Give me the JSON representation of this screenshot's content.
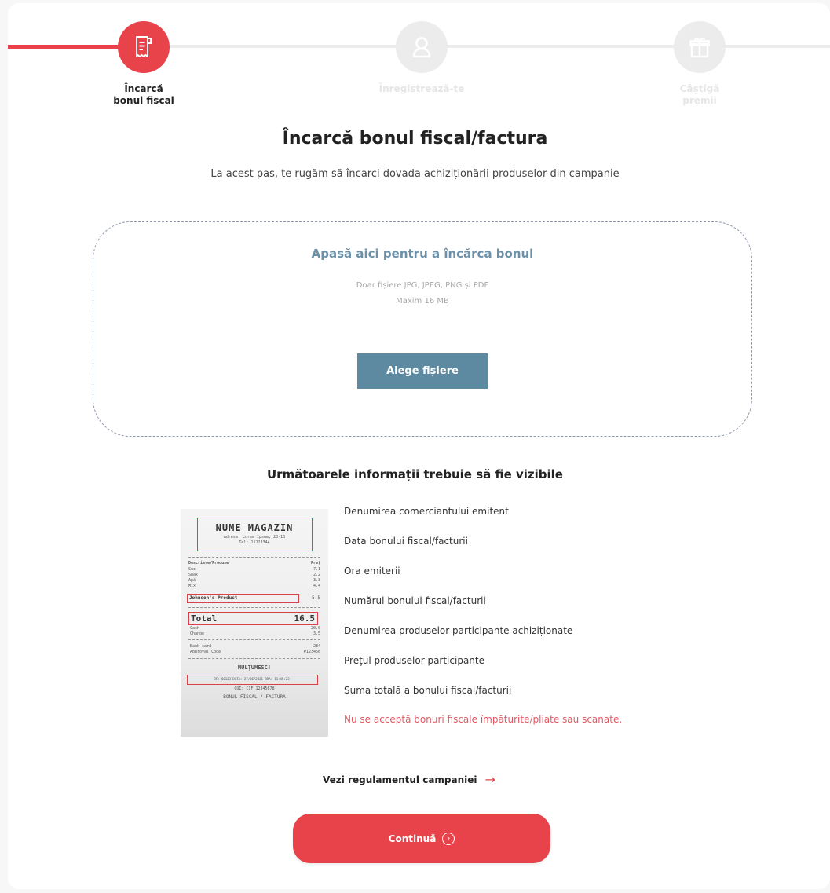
{
  "colors": {
    "accent": "#e8434a",
    "upload_blue": "#5d8aa1",
    "upload_title": "#6b90a8",
    "inactive": "#ececec",
    "warning": "#e05a63"
  },
  "stepper": {
    "steps": [
      {
        "label_line1": "Încarcă",
        "label_line2": "bonul fiscal",
        "icon": "receipt-icon",
        "state": "active"
      },
      {
        "label_line1": "Înregistrează-te",
        "label_line2": "",
        "icon": "user-icon",
        "state": "inactive"
      },
      {
        "label_line1": "Câștigă",
        "label_line2": "premii",
        "icon": "gift-icon",
        "state": "inactive"
      }
    ]
  },
  "main": {
    "title": "Încarcă bonul fiscal/factura",
    "subtitle": "La acest pas, te rugăm să încarci dovada achiziționării produselor din campanie"
  },
  "upload": {
    "title": "Apasă aici pentru a încărca bonul",
    "hint_types": "Doar fișiere JPG, JPEG, PNG și PDF",
    "hint_size": "Maxim 16 MB",
    "button_label": "Alege fișiere"
  },
  "requirements": {
    "title": "Următoarele informații trebuie să fie vizibile",
    "items": [
      "Denumirea comerciantului emitent",
      "Data bonului fiscal/facturii",
      "Ora emiterii",
      "Numărul bonului fiscal/facturii",
      "Denumirea produselor participante achiziționate",
      "Prețul produselor participante",
      "Suma totală a bonului fiscal/facturii"
    ],
    "warning": "Nu se acceptă bonuri fiscale împăturite/pliate sau scanate."
  },
  "receipt": {
    "store": "NUME MAGAZIN",
    "address": "Adresa: Lorem Ipsum, 23-13",
    "phone": "Tel: 11223344",
    "col_desc": "Descriere/Produse",
    "col_price": "Preț",
    "lines": [
      {
        "name": "Suc",
        "price": "7.1"
      },
      {
        "name": "Snax",
        "price": "2.2"
      },
      {
        "name": "Apă",
        "price": "3.3"
      },
      {
        "name": "Mix",
        "price": "4.4"
      }
    ],
    "product": "Johnson's Product",
    "product_price": "5.5",
    "total_label": "Total",
    "total_value": "16.5",
    "cash_label": "Cash",
    "cash_value": "20.0",
    "change_label": "Change",
    "change_value": "3.5",
    "card_label": "Bank card",
    "card_value": "234",
    "approval_label": "Approval Code",
    "approval_value": "#123456",
    "thanks": "MULȚUMESC!",
    "bon_line": "BF: 00123  DATA: 27/06/2021  ORA: 11:45:23",
    "cui_line": "CUI: CIF 12345678",
    "footer": "BONUL FISCAL / FACTURA"
  },
  "footer": {
    "rules_link": "Vezi regulamentul campaniei",
    "rules_arrow": "→",
    "continue_label": "Continuă",
    "continue_icon": "›"
  }
}
